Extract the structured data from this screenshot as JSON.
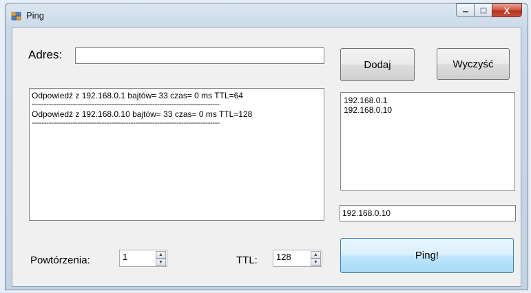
{
  "window": {
    "title": "Ping",
    "close_glyph": "X"
  },
  "address": {
    "label": "Adres:",
    "value": ""
  },
  "buttons": {
    "add": "Dodaj",
    "clear": "Wyczyść",
    "ping": "Ping!"
  },
  "log": {
    "lines": [
      "Odpowiedź z 192.168.0.1 bajtów= 33 czas= 0 ms TTL=64",
      "Odpowiedź z 192.168.0.10 bajtów= 33 czas= 0 ms TTL=128"
    ],
    "separator": "------------------------------------------------------------------------------"
  },
  "address_list": {
    "items": [
      "192.168.0.1",
      "192.168.0.10"
    ]
  },
  "selected_address": "192.168.0.10",
  "repetitions": {
    "label": "Powtórzenia:",
    "value": "1"
  },
  "ttl": {
    "label": "TTL:",
    "value": "128"
  },
  "icons": [
    "app-icon",
    "minimize-icon",
    "maximize-icon",
    "close-icon",
    "spin-up-icon",
    "spin-down-icon"
  ]
}
